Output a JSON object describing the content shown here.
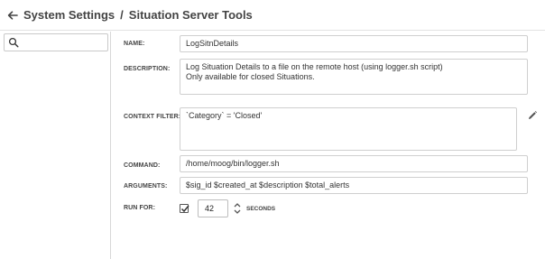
{
  "header": {
    "root": "System Settings",
    "separator": "/",
    "current": "Situation Server Tools"
  },
  "sidebar": {
    "search": {
      "value": "",
      "placeholder": ""
    }
  },
  "form": {
    "name": {
      "label": "NAME:",
      "value": "LogSitnDetails"
    },
    "description": {
      "label": "DESCRIPTION:",
      "lines": [
        "Log Situation Details to a file on the remote host (using logger.sh script)",
        "Only available for closed Situations."
      ]
    },
    "context_filter": {
      "label": "CONTEXT FILTER:",
      "value": "`Category` = 'Closed'"
    },
    "command": {
      "label": "COMMAND:",
      "value": "/home/moog/bin/logger.sh"
    },
    "arguments": {
      "label": "ARGUMENTS:",
      "value": "$sig_id $created_at $description $total_alerts"
    },
    "run_for": {
      "label": "RUN FOR:",
      "checked": true,
      "value": "42",
      "unit": "SECONDS"
    }
  },
  "icons": {
    "back": "arrow-left-icon",
    "search": "search-icon",
    "edit": "pencil-icon",
    "stepper": "stepper-icon"
  }
}
